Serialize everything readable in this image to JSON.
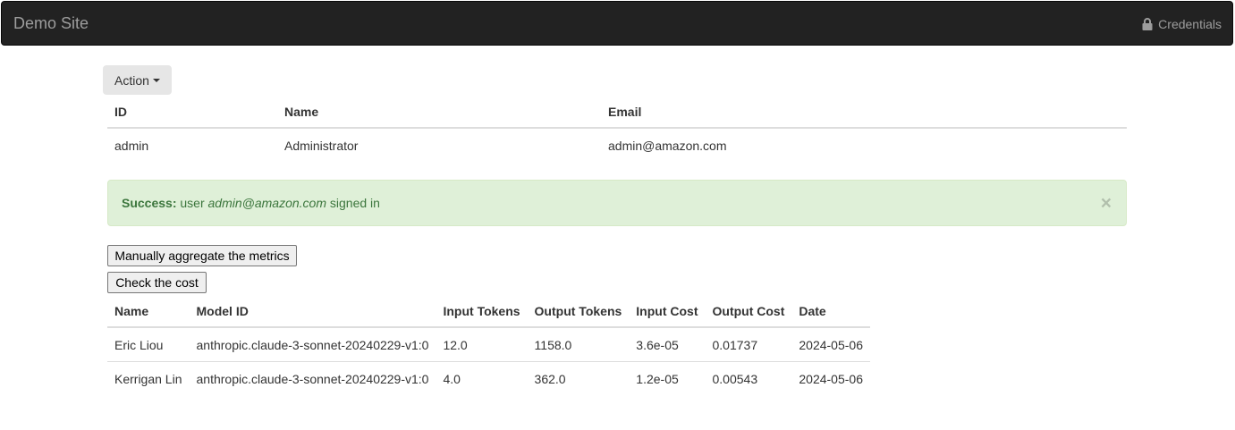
{
  "navbar": {
    "brand": "Demo Site",
    "credentials_label": "Credentials"
  },
  "action_menu": {
    "label": "Action"
  },
  "users_table": {
    "headers": [
      "ID",
      "Name",
      "Email"
    ],
    "rows": [
      [
        "admin",
        "Administrator",
        "admin@amazon.com"
      ]
    ]
  },
  "alert": {
    "title": "Success:",
    "prefix": " user ",
    "email": "admin@amazon.com",
    "suffix": " signed in",
    "close": "×"
  },
  "buttons": {
    "aggregate": "Manually aggregate the metrics",
    "check_cost": "Check the cost"
  },
  "cost_table": {
    "headers": [
      "Name",
      "Model ID",
      "Input Tokens",
      "Output Tokens",
      "Input Cost",
      "Output Cost",
      "Date"
    ],
    "rows": [
      [
        "Eric Liou",
        "anthropic.claude-3-sonnet-20240229-v1:0",
        "12.0",
        "1158.0",
        "3.6e-05",
        "0.01737",
        "2024-05-06"
      ],
      [
        "Kerrigan Lin",
        "anthropic.claude-3-sonnet-20240229-v1:0",
        "4.0",
        "362.0",
        "1.2e-05",
        "0.00543",
        "2024-05-06"
      ]
    ]
  },
  "icons": {
    "credentials": "lock-icon",
    "action": "caret-down-icon"
  },
  "colors": {
    "navbar_bg": "#222222",
    "navbar_text": "#9d9d9d",
    "alert_bg": "#dff0d8",
    "alert_text": "#3c763d"
  }
}
